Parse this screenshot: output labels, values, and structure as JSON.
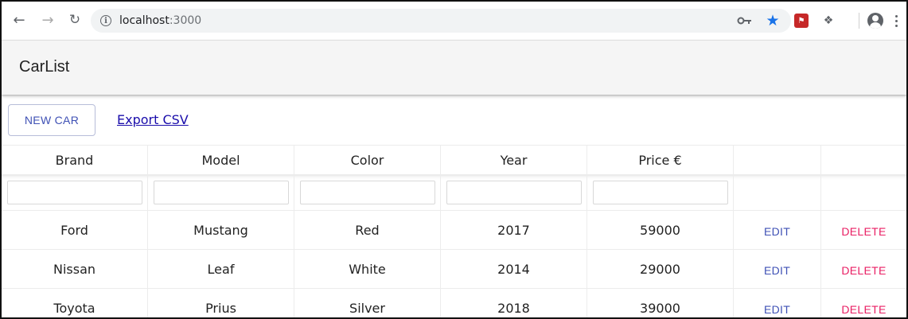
{
  "browser": {
    "url_host": "localhost",
    "url_port": ":3000"
  },
  "app": {
    "title": "CarList"
  },
  "toolbar": {
    "new_car_label": "NEW CAR",
    "export_label": "Export CSV"
  },
  "table": {
    "columns": [
      "Brand",
      "Model",
      "Color",
      "Year",
      "Price €"
    ],
    "rows": [
      {
        "brand": "Ford",
        "model": "Mustang",
        "color": "Red",
        "year": "2017",
        "price": "59000",
        "edit": "EDIT",
        "delete": "DELETE"
      },
      {
        "brand": "Nissan",
        "model": "Leaf",
        "color": "White",
        "year": "2014",
        "price": "29000",
        "edit": "EDIT",
        "delete": "DELETE"
      },
      {
        "brand": "Toyota",
        "model": "Prius",
        "color": "Silver",
        "year": "2018",
        "price": "39000",
        "edit": "EDIT",
        "delete": "DELETE"
      }
    ]
  },
  "colors": {
    "primary": "#3f51b5",
    "secondary": "#e91e63",
    "appbar": "#f5f5f5"
  },
  "icons": [
    "back-arrow-icon",
    "forward-arrow-icon",
    "reload-icon",
    "info-icon",
    "key-icon",
    "star-icon",
    "extension-icon",
    "extension-icon-2",
    "account-icon",
    "menu-icon"
  ]
}
